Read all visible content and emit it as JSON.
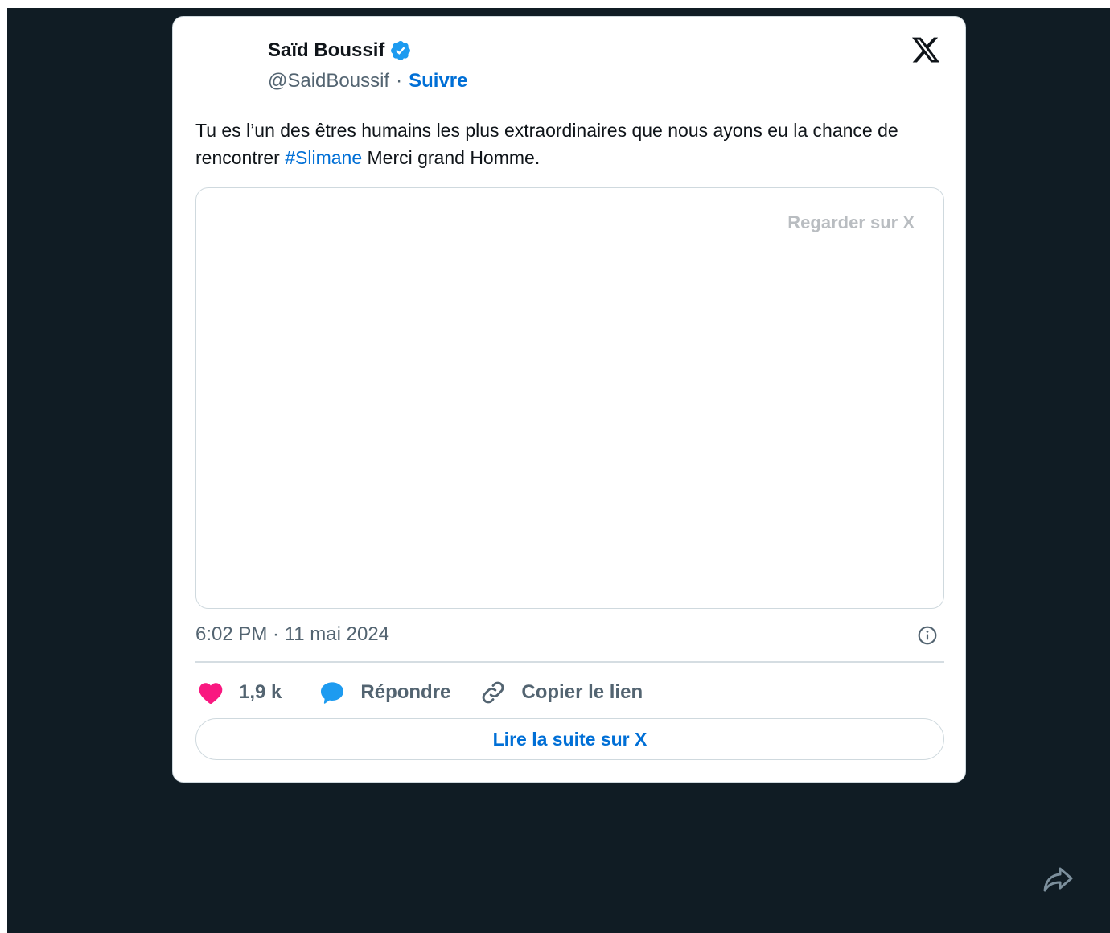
{
  "tweet": {
    "author_name": "Saïd Boussif",
    "handle": "@SaidBoussif",
    "separator": "·",
    "follow_label": "Suivre",
    "text_before_hashtag": "Tu es l’un des êtres humains les plus extraordinaires que nous ayons eu la chance de rencontrer ",
    "hashtag": "#Slimane",
    "text_after_hashtag": " Merci grand Homme.",
    "media": {
      "watch_label": "Regarder sur X"
    },
    "timestamp": "6:02 PM · 11 mai 2024",
    "actions": {
      "like_count": "1,9 k",
      "reply_label": "Répondre",
      "copy_link_label": "Copier le lien"
    },
    "read_more_label": "Lire la suite sur X"
  },
  "colors": {
    "background": "#101c24",
    "card": "#ffffff",
    "link": "#006fd6",
    "like": "#f91880",
    "reply": "#1d9bf0",
    "verified": "#1d9bf0",
    "muted_text": "#536471"
  },
  "icons": {
    "verified": "verified-badge-icon",
    "x_logo": "x-logo-icon",
    "info": "info-icon",
    "like": "heart-icon",
    "reply": "speech-bubble-icon",
    "copy_link": "link-icon",
    "share": "share-arrow-icon"
  }
}
